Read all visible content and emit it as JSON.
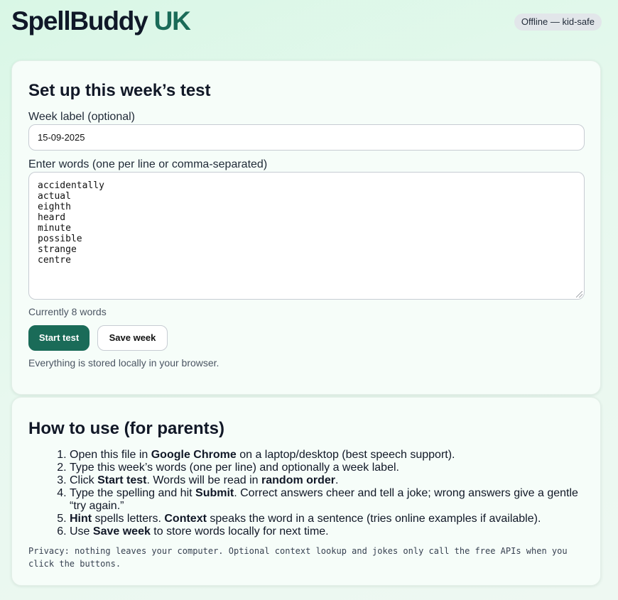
{
  "header": {
    "brand_main": "SpellBuddy",
    "brand_accent": "UK",
    "status_badge": "Offline — kid-safe"
  },
  "setup": {
    "title": "Set up this week’s test",
    "week_label": "Week label (optional)",
    "week_value": "15-09-2025",
    "words_label": "Enter words (one per line or comma-separated)",
    "words": [
      "accidentally",
      "actual",
      "eighth",
      "heard",
      "minute",
      "possible",
      "strange",
      "centre"
    ],
    "word_count_text": "Currently 8 words",
    "start_label": "Start test",
    "save_label": "Save week",
    "storage_note": "Everything is stored locally in your browser."
  },
  "howto": {
    "title": "How to use (for parents)",
    "steps": [
      [
        {
          "t": "Open this file in "
        },
        {
          "t": "Google Chrome",
          "b": true
        },
        {
          "t": " on a laptop/desktop (best speech support)."
        }
      ],
      [
        {
          "t": "Type this week’s words (one per line) and optionally a week label."
        }
      ],
      [
        {
          "t": "Click "
        },
        {
          "t": "Start test",
          "b": true
        },
        {
          "t": ". Words will be read in "
        },
        {
          "t": "random order",
          "b": true
        },
        {
          "t": "."
        }
      ],
      [
        {
          "t": "Type the spelling and hit "
        },
        {
          "t": "Submit",
          "b": true
        },
        {
          "t": ". Correct answers cheer and tell a joke; wrong answers give a gentle “try again.”"
        }
      ],
      [
        {
          "t": "Hint",
          "b": true
        },
        {
          "t": " spells letters. "
        },
        {
          "t": "Context",
          "b": true
        },
        {
          "t": " speaks the word in a sentence (tries online examples if available)."
        }
      ],
      [
        {
          "t": "Use "
        },
        {
          "t": "Save week",
          "b": true
        },
        {
          "t": " to store words locally for next time."
        }
      ]
    ],
    "privacy": "Privacy: nothing leaves your computer. Optional context lookup and jokes only call the free APIs when you click the buttons."
  },
  "colors": {
    "accent": "#1a6b58",
    "background": "#dcf7e8"
  }
}
